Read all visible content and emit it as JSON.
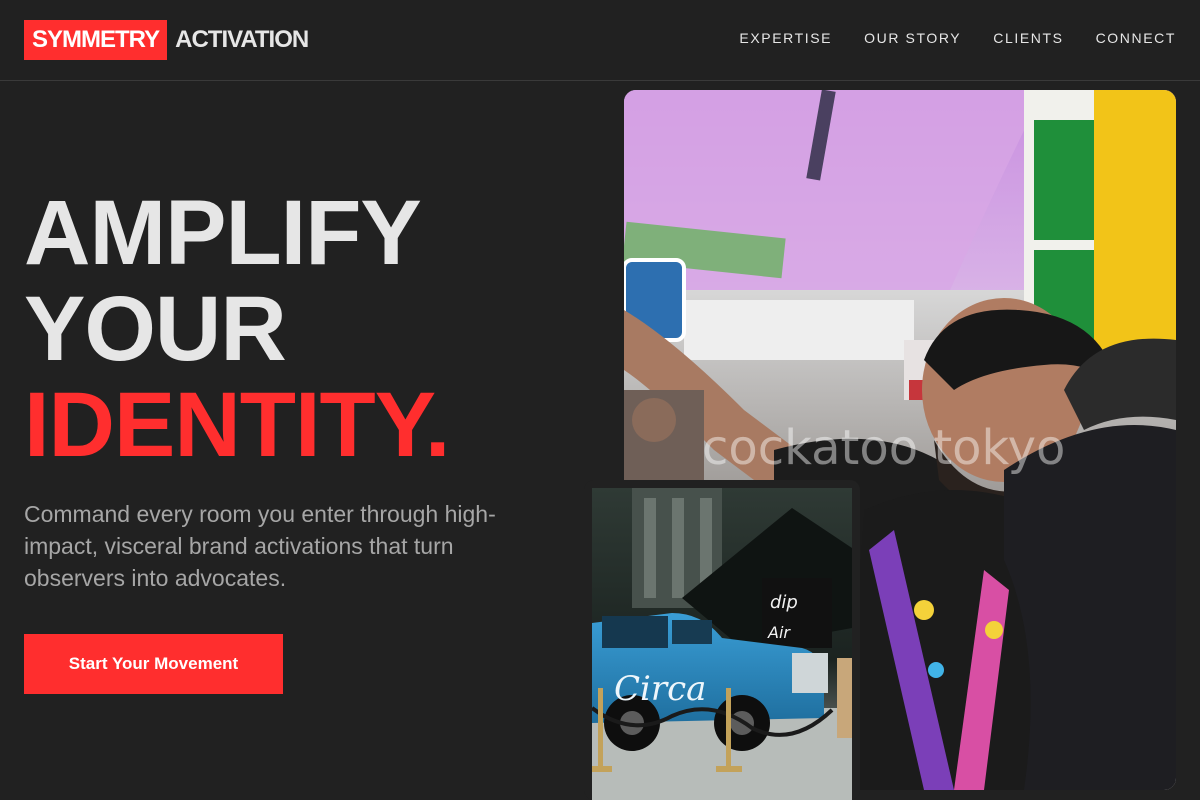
{
  "brand": {
    "mark": "SYMMETRY",
    "word": "ACTIVATION",
    "accent_color": "#ff2e2e"
  },
  "nav": {
    "items": [
      {
        "label": "EXPERTISE"
      },
      {
        "label": "OUR STORY"
      },
      {
        "label": "CLIENTS"
      },
      {
        "label": "CONNECT"
      }
    ]
  },
  "hero": {
    "line1": "AMPLIFY",
    "line2": "YOUR",
    "line3": "IDENTITY.",
    "subtitle": "Command every room you enter through high-impact, visceral brand activations that turn observers into advocates.",
    "cta_label": "Start Your Movement"
  },
  "images": {
    "main_watermark": "cockatoo tokyo",
    "inset_vehicle_text": "Circa"
  }
}
